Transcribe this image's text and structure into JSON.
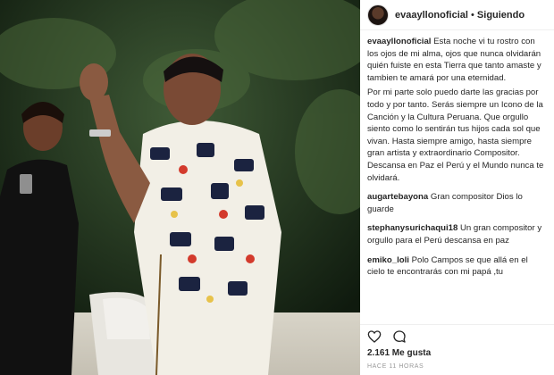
{
  "post": {
    "username": "evaayllonoficial",
    "separator": "•",
    "follow_status": "Siguiendo",
    "caption_p1": "Esta noche vi tu rostro con los ojos de mi alma, ojos que nunca olvidarán quién fuiste en esta Tierra que tanto amaste y tambien te amará por una eternidad.",
    "caption_p2": "Por mi parte solo puedo darte las gracias por todo y por tanto. Serás siempre un Icono de la Canción y la Cultura Peruana. Que orgullo siento como lo sentirán tus hijos cada sol que vivan. Hasta siempre amigo, hasta siempre gran artista y extraordinario Compositor. Descansa en Paz el Perú y el Mundo nunca te olvidará.",
    "likes": "2.161 Me gusta",
    "timestamp": "HACE 11 HORAS"
  },
  "comments": [
    {
      "user": "augartebayona",
      "text": "Gran compositor Dios lo guarde"
    },
    {
      "user": "stephanysurichaqui18",
      "text": "Un gran compositor y orgullo para el Perú descansa en paz"
    },
    {
      "user": "emiko_loli",
      "text": "Polo Campos se que allá en el cielo te encontrarás con mi papá ,tu"
    }
  ],
  "icons": {
    "avatar": "profile-avatar",
    "like": "heart-icon",
    "comment": "comment-bubble-icon"
  },
  "colors": {
    "text": "#262626",
    "muted": "#999999",
    "border": "#efefef"
  }
}
